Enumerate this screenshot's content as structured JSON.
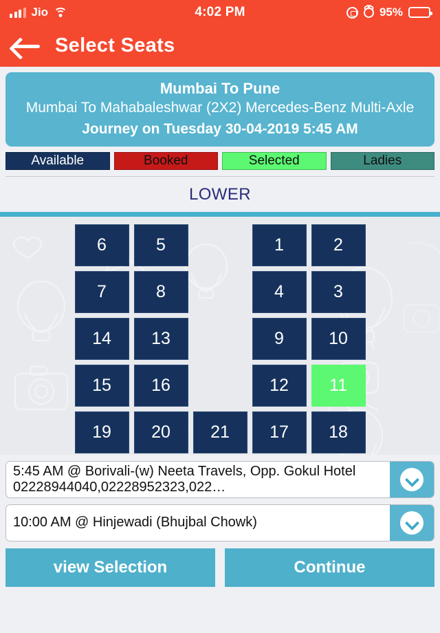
{
  "status_bar": {
    "carrier": "Jio",
    "time": "4:02 PM",
    "battery_percent": "95%",
    "icons": [
      "signal-bars-icon",
      "wifi-icon",
      "rotation-lock-icon",
      "alarm-clock-icon",
      "battery-icon"
    ]
  },
  "app_bar": {
    "back_icon": "back-arrow-icon",
    "title": "Select Seats"
  },
  "trip": {
    "route": "Mumbai To Pune",
    "bus": "Mumbai To Mahabaleshwar (2X2) Mercedes-Benz Multi-Axle",
    "journey": "Journey on Tuesday 30-04-2019 5:45 AM",
    "card_color": "#58b4cf"
  },
  "legend": [
    {
      "label": "Available",
      "bg": "#16325c",
      "fg": "#ffffff"
    },
    {
      "label": "Booked",
      "bg": "#c61a19",
      "fg": "#101010"
    },
    {
      "label": "Selected",
      "bg": "#5cf871",
      "fg": "#101010"
    },
    {
      "label": "Ladies",
      "bg": "#3d8c7f",
      "fg": "#101010"
    }
  ],
  "deck": {
    "title": "LOWER",
    "rows": [
      [
        {
          "number": "6",
          "state": "available"
        },
        {
          "number": "5",
          "state": "available"
        },
        {
          "number": "",
          "state": "aisle"
        },
        {
          "number": "1",
          "state": "available"
        },
        {
          "number": "2",
          "state": "available"
        }
      ],
      [
        {
          "number": "7",
          "state": "available"
        },
        {
          "number": "8",
          "state": "available"
        },
        {
          "number": "",
          "state": "aisle"
        },
        {
          "number": "4",
          "state": "available"
        },
        {
          "number": "3",
          "state": "available"
        }
      ],
      [
        {
          "number": "14",
          "state": "available"
        },
        {
          "number": "13",
          "state": "available"
        },
        {
          "number": "",
          "state": "aisle"
        },
        {
          "number": "9",
          "state": "available"
        },
        {
          "number": "10",
          "state": "available"
        }
      ],
      [
        {
          "number": "15",
          "state": "available"
        },
        {
          "number": "16",
          "state": "available"
        },
        {
          "number": "",
          "state": "aisle"
        },
        {
          "number": "12",
          "state": "available"
        },
        {
          "number": "11",
          "state": "selected"
        }
      ],
      [
        {
          "number": "19",
          "state": "available"
        },
        {
          "number": "20",
          "state": "available"
        },
        {
          "number": "21",
          "state": "available"
        },
        {
          "number": "17",
          "state": "available"
        },
        {
          "number": "18",
          "state": "available"
        }
      ]
    ]
  },
  "boarding": {
    "pickup": "5:45 AM @ Borivali-(w) Neeta Travels,  Opp. Gokul Hotel 02228944040,02228952323,022…",
    "dropoff": "10:00 AM @ Hinjewadi (Bhujbal Chowk)",
    "chevron_icon": "chevron-down-icon"
  },
  "footer": {
    "view_selection": "view Selection",
    "continue": "Continue"
  }
}
